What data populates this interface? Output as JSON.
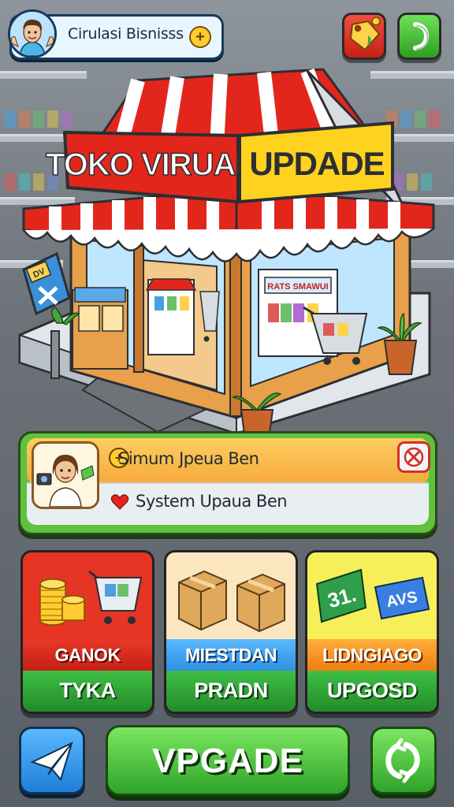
{
  "profile": {
    "name": "Cirulasi Bisnisss",
    "avatar_icon": "man-avatar-icon",
    "add_icon": "plus-coin-icon"
  },
  "top_buttons": [
    {
      "icon": "price-tag-icon"
    },
    {
      "icon": "next-arrow-icon"
    }
  ],
  "store": {
    "sign_left": "TOKO VIRUAL",
    "sign_right": "UPDADE",
    "side_sign": "DV",
    "shelf_banner": "RATS SMAWUI"
  },
  "info_panel": {
    "line1": "Simum Jpeua Ben",
    "line2": "System Upaua Ben",
    "line1_icon": "plus-coin-icon",
    "line2_icon": "heart-icon",
    "close_icon": "close-icon"
  },
  "cards": [
    {
      "label": "GANOK",
      "sub": "TYKA",
      "icon": "coins-cart-icon"
    },
    {
      "label": "MIESTDAN",
      "sub": "PRADN",
      "icon": "boxes-icon"
    },
    {
      "label": "LIDNGIAGO",
      "sub": "UPGOSD",
      "icon": "cash-icon",
      "art_text_1": "31.",
      "art_text_2": "AVS"
    }
  ],
  "bottom": {
    "main_label": "VPGADE",
    "left_icon": "send-icon",
    "right_icon": "refresh-icon"
  },
  "colors": {
    "awning_red": "#e3261c",
    "sign_yellow": "#ffd21f",
    "panel_green": "#5fc23c",
    "button_green": "#2fa32a"
  }
}
